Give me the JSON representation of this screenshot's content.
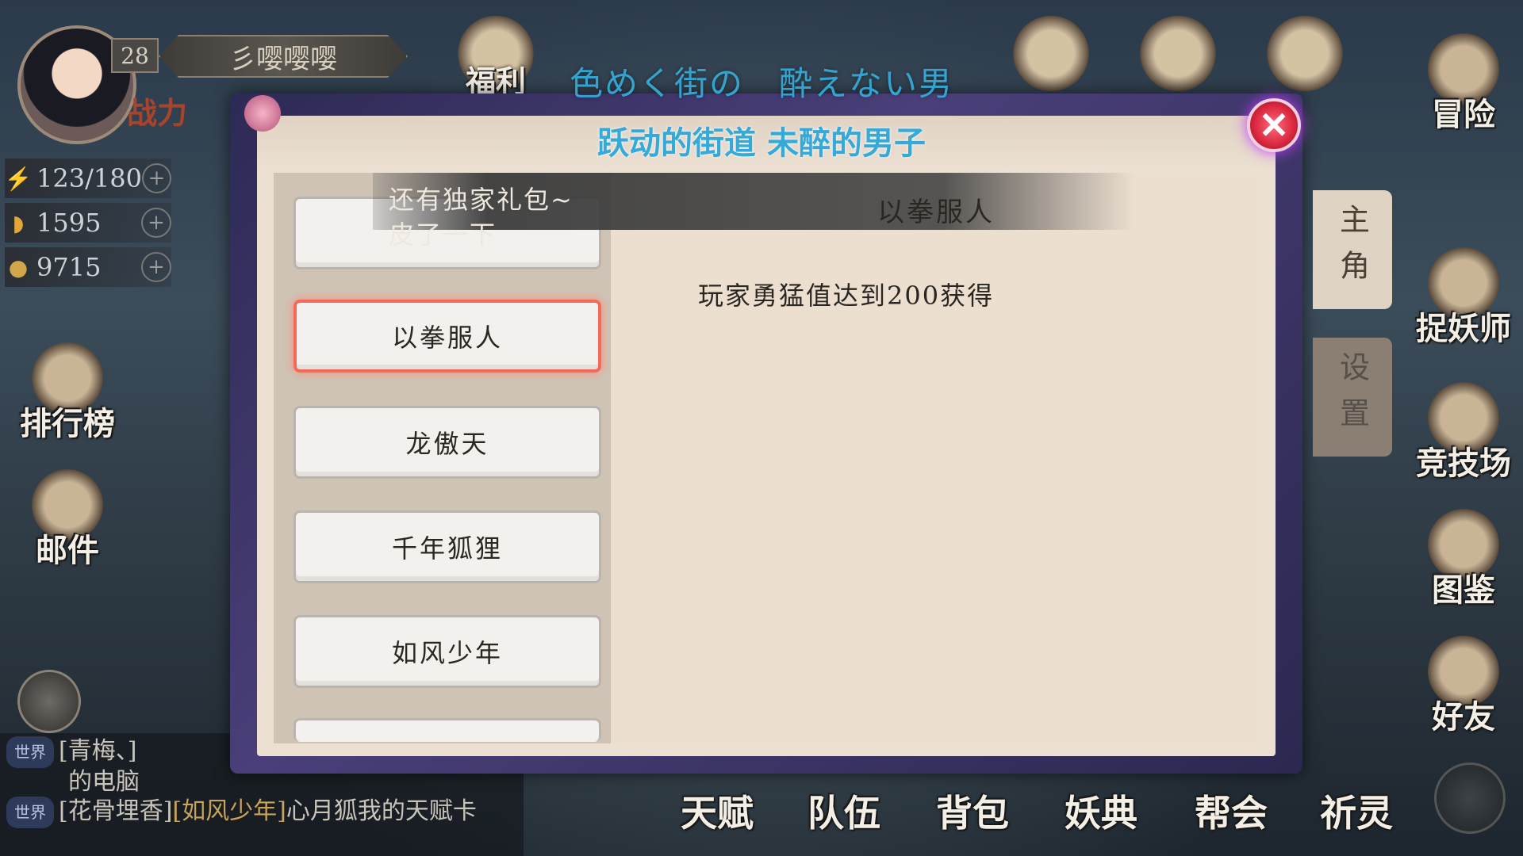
{
  "player": {
    "level": "28",
    "name": "彡嘤嘤嘤",
    "power_label": "战力"
  },
  "resources": [
    {
      "icon": "lightning-icon",
      "value": "123/180"
    },
    {
      "icon": "gold-ingot-icon",
      "value": "1595"
    },
    {
      "icon": "coin-icon",
      "value": "9715"
    }
  ],
  "top_menu": [
    "福利"
  ],
  "left_menu": {
    "rank": "排行榜",
    "mail": "邮件"
  },
  "right_menu": {
    "adventure": "冒险",
    "hunter": "捉妖师",
    "arena": "竞技场",
    "atlas": "图鉴",
    "friends": "好友"
  },
  "bottom_menu": [
    "天赋",
    "队伍",
    "背包",
    "妖典",
    "帮会",
    "祈灵"
  ],
  "chat": [
    {
      "tag": "世界",
      "user": "[青梅、]",
      "text": "的电脑"
    },
    {
      "tag": "世界",
      "user": "[花骨埋香]",
      "mention": "[如风少年]",
      "text": "心月狐我的天赋卡"
    }
  ],
  "overlay": {
    "title_jp": "色めく街の　酔えない男",
    "title_cn": "跃动的街道 未醉的男子",
    "banner_lines": [
      "还有独家礼包~",
      "皮了一下"
    ]
  },
  "modal": {
    "title_list": [
      "",
      "以拳服人",
      "龙傲天",
      "千年狐狸",
      "如风少年",
      ""
    ],
    "selected_title": "以拳服人",
    "selected_description": "玩家勇猛值达到200获得",
    "side_tabs": [
      "主角",
      "设置"
    ]
  }
}
